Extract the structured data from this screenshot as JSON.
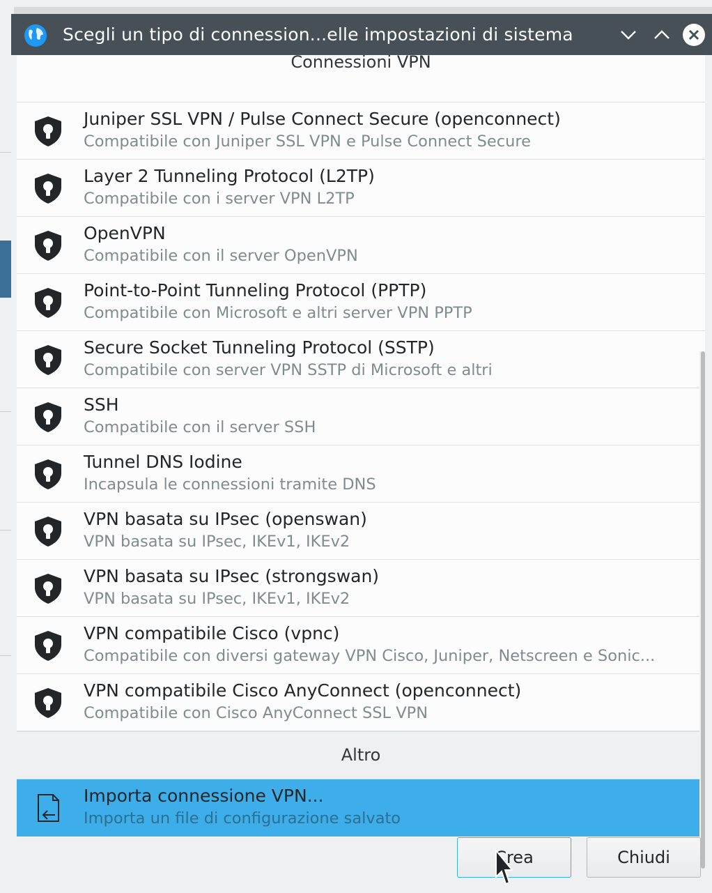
{
  "window": {
    "title": "Scegli un tipo di connession...elle impostazioni di sistema",
    "buttons": [
      "minimize",
      "maximize",
      "close"
    ]
  },
  "sections": {
    "vpn_header": "Connessioni VPN",
    "other_header": "Altro"
  },
  "vpn_items": [
    {
      "name": "Juniper SSL VPN / Pulse Connect Secure (openconnect)",
      "desc": "Compatibile con Juniper SSL VPN e Pulse Connect Secure"
    },
    {
      "name": "Layer 2 Tunneling Protocol (L2TP)",
      "desc": "Compatibile con i server VPN L2TP"
    },
    {
      "name": "OpenVPN",
      "desc": "Compatibile con il server OpenVPN"
    },
    {
      "name": "Point-to-Point Tunneling Protocol (PPTP)",
      "desc": "Compatibile con Microsoft e altri server VPN PPTP"
    },
    {
      "name": "Secure Socket Tunneling Protocol (SSTP)",
      "desc": "Compatibile con server VPN SSTP di Microsoft e altri"
    },
    {
      "name": "SSH",
      "desc": "Compatibile con il server SSH"
    },
    {
      "name": "Tunnel DNS Iodine",
      "desc": "Incapsula le connessioni tramite DNS"
    },
    {
      "name": "VPN basata su IPsec (openswan)",
      "desc": "VPN basata su IPsec, IKEv1, IKEv2"
    },
    {
      "name": "VPN basata su IPsec (strongswan)",
      "desc": "VPN basata su IPsec, IKEv1, IKEv2"
    },
    {
      "name": "VPN compatibile Cisco (vpnc)",
      "desc": "Compatibile con diversi gateway VPN Cisco, Juniper, Netscreen e Sonic..."
    },
    {
      "name": "VPN compatibile Cisco AnyConnect (openconnect)",
      "desc": "Compatibile con Cisco AnyConnect SSL VPN"
    }
  ],
  "other_items": [
    {
      "name": "Importa connessione VPN...",
      "desc": "Importa un file di configurazione salvato",
      "selected": true
    }
  ],
  "footer": {
    "create_label": "Crea",
    "close_label": "Chiudi"
  },
  "icons": {
    "vpn_item": "shield-lock-icon",
    "import_item": "import-file-icon",
    "app": "globe-icon"
  },
  "colors": {
    "titlebar": "#475057",
    "selection": "#3daee9",
    "list_bg": "#fcfcfc"
  }
}
